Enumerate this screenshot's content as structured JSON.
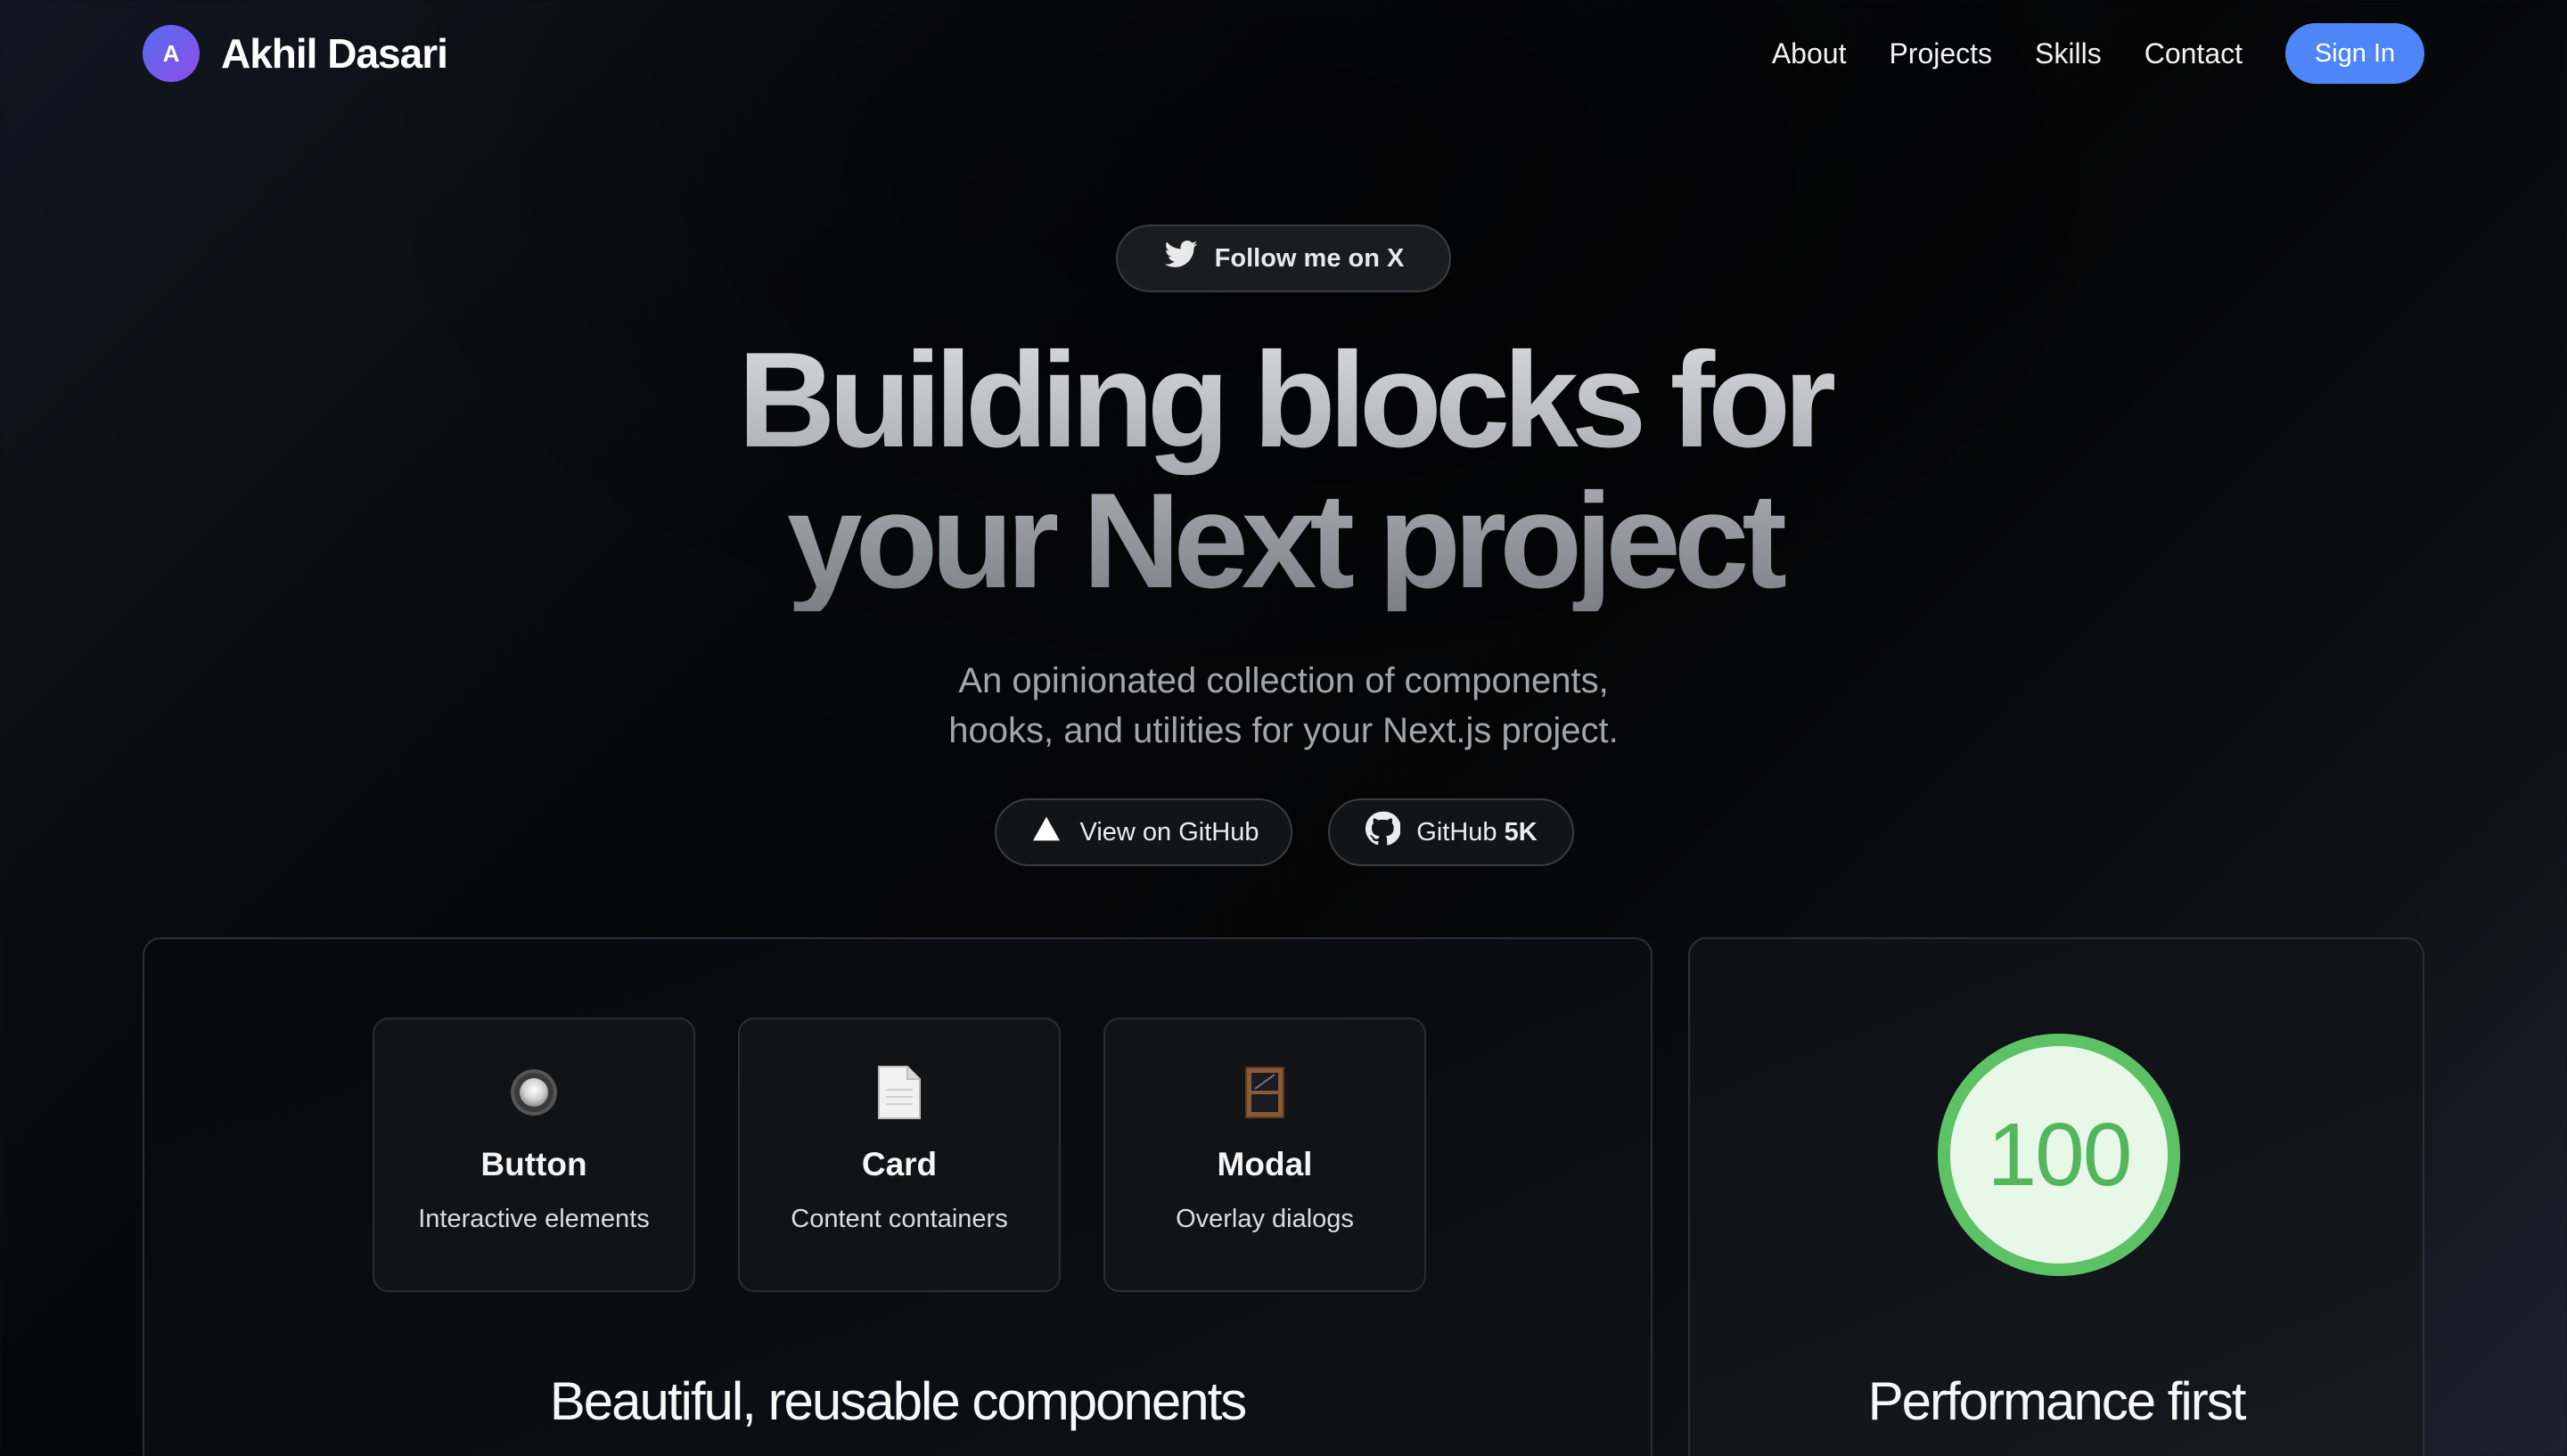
{
  "nav": {
    "logo_initial": "A",
    "brand_name": "Akhil Dasari",
    "links": [
      "About",
      "Projects",
      "Skills",
      "Contact"
    ],
    "signin_label": "Sign In"
  },
  "hero": {
    "follow_label": "Follow me on X",
    "headline_line1": "Building blocks for",
    "headline_line2": "your Next project",
    "subtitle_line1": "An opinionated collection of components,",
    "subtitle_line2": "hooks, and utilities for your Next.js project.",
    "cta_github_label": "View on GitHub",
    "cta_stars_label": "GitHub",
    "cta_stars_count": "5K"
  },
  "components_panel": {
    "cards": [
      {
        "icon": "radio-button-icon",
        "title": "Button",
        "desc": "Interactive elements"
      },
      {
        "icon": "document-icon",
        "title": "Card",
        "desc": "Content containers"
      },
      {
        "icon": "window-icon",
        "title": "Modal",
        "desc": "Overlay dialogs"
      }
    ],
    "title": "Beautiful, reusable components"
  },
  "performance_panel": {
    "score": "100",
    "title": "Performance first"
  },
  "colors": {
    "accent": "#4f86f7",
    "score_green": "#5cc265",
    "logo_gradient_start": "#5a6cf0",
    "logo_gradient_end": "#8a4de6"
  }
}
